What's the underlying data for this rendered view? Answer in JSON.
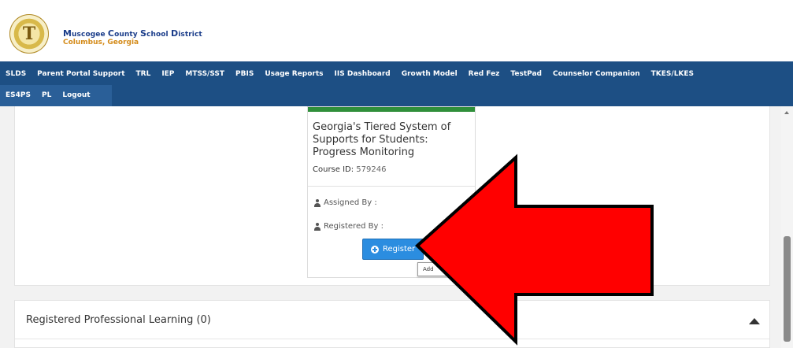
{
  "header": {
    "district_name_parts": [
      "M",
      "uscogee ",
      "C",
      "ounty ",
      "S",
      "chool ",
      "D",
      "istrict"
    ],
    "district_city": "Columbus, Georgia"
  },
  "nav": {
    "row1": [
      "SLDS",
      "Parent Portal Support",
      "TRL",
      "IEP",
      "MTSS/SST",
      "PBIS",
      "Usage Reports",
      "IIS Dashboard",
      "Growth Model",
      "Red Fez",
      "TestPad",
      "Counselor Companion",
      "TKES/LKES"
    ],
    "row2": [
      "ES4PS",
      "PL",
      "Logout"
    ]
  },
  "course_card": {
    "title": "Georgia's Tiered System of Supports for Students: Progress Monitoring",
    "course_id_label": "Course ID:",
    "course_id": "579246",
    "assigned_by_label": "Assigned By :",
    "registered_by_label": "Registered By :",
    "register_button_label": "Register",
    "tooltip_text": "Add"
  },
  "sections": {
    "registered_pl_title": "Registered Professional Learning (0)"
  },
  "colors": {
    "nav_bg": "#1d4f84",
    "register_button": "#2b8de0",
    "card_accent": "#2f8f3a",
    "arrow": "#ff0000"
  }
}
